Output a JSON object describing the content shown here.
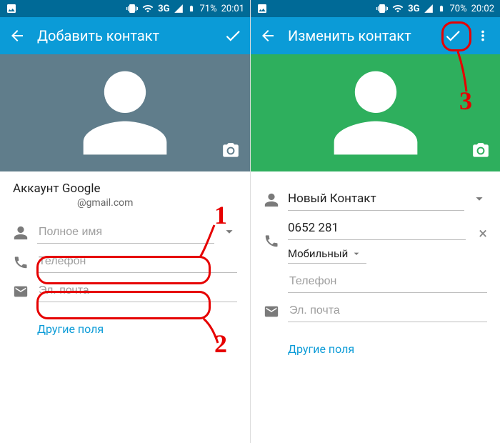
{
  "left": {
    "status": {
      "network": "3G",
      "battery": "71%",
      "time": "20:01"
    },
    "title": "Добавить контакт",
    "account": {
      "title": "Аккаунт Google",
      "email": "@gmail.com"
    },
    "fields": {
      "name_placeholder": "Полное имя",
      "phone_placeholder": "Телефон",
      "email_placeholder": "Эл. почта"
    },
    "more_fields": "Другие поля"
  },
  "right": {
    "status": {
      "network": "3G",
      "battery": "70%",
      "time": "20:02"
    },
    "title": "Изменить контакт",
    "contact_name": "Новый Контакт",
    "phone_value": "0652 281",
    "phone_type": "Мобильный",
    "phone_placeholder": "Телефон",
    "email_placeholder": "Эл. почта",
    "more_fields": "Другие поля"
  },
  "annotations": {
    "n1": "1",
    "n2": "2",
    "n3": "3"
  }
}
